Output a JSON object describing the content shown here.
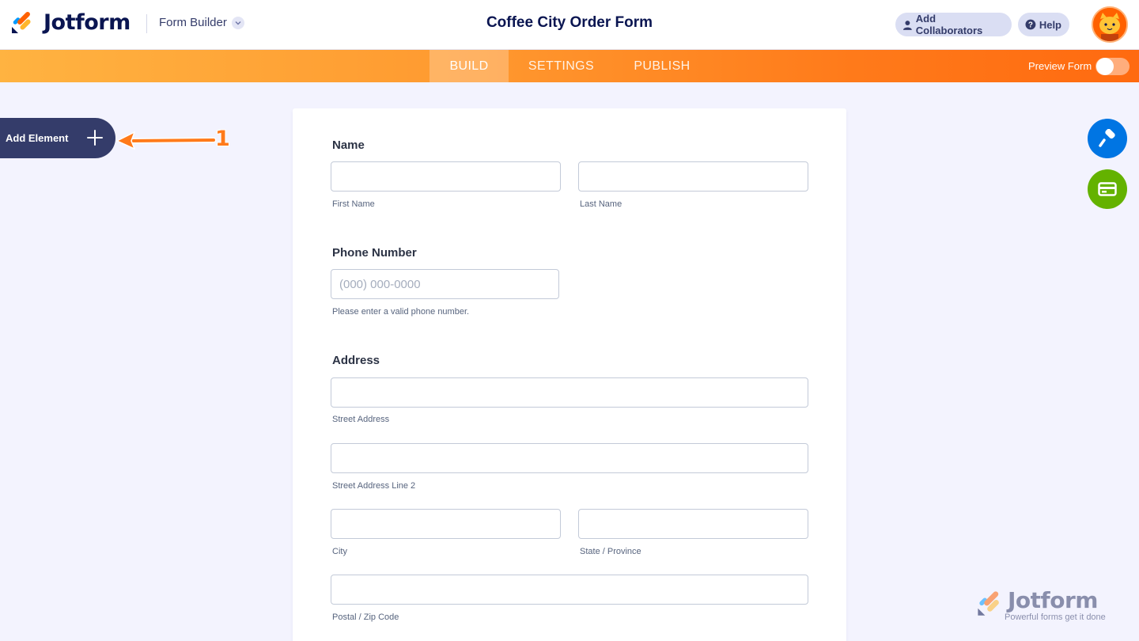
{
  "header": {
    "brand": "Jotform",
    "builder_label": "Form Builder",
    "form_title": "Coffee City Order Form",
    "add_collaborators": "Add Collaborators",
    "help": "Help"
  },
  "nav": {
    "tabs": [
      {
        "label": "BUILD",
        "active": true
      },
      {
        "label": "SETTINGS",
        "active": false
      },
      {
        "label": "PUBLISH",
        "active": false
      }
    ],
    "preview_label": "Preview Form",
    "preview_on": false
  },
  "sidebar": {
    "add_element_label": "Add Element",
    "annotation_number": "1"
  },
  "form": {
    "name": {
      "label": "Name",
      "first_sub": "First Name",
      "last_sub": "Last Name",
      "first_value": "",
      "last_value": ""
    },
    "phone": {
      "label": "Phone Number",
      "placeholder": "(000) 000-0000",
      "hint": "Please enter a valid phone number."
    },
    "address": {
      "label": "Address",
      "street_sub": "Street Address",
      "street2_sub": "Street Address Line 2",
      "city_sub": "City",
      "state_sub": "State / Province",
      "zip_sub": "Postal / Zip Code"
    }
  },
  "watermark": {
    "brand": "Jotform",
    "tagline": "Powerful forms get it done"
  },
  "colors": {
    "navy": "#0a1551",
    "orange": "#ff6100",
    "designer_blue": "#0075e3",
    "payment_green": "#64b200",
    "add_element_bg": "#343c6a"
  },
  "icons": {
    "collaborator": "user-icon",
    "help": "question-icon",
    "designer": "paint-roller-icon",
    "payment": "credit-card-icon"
  }
}
